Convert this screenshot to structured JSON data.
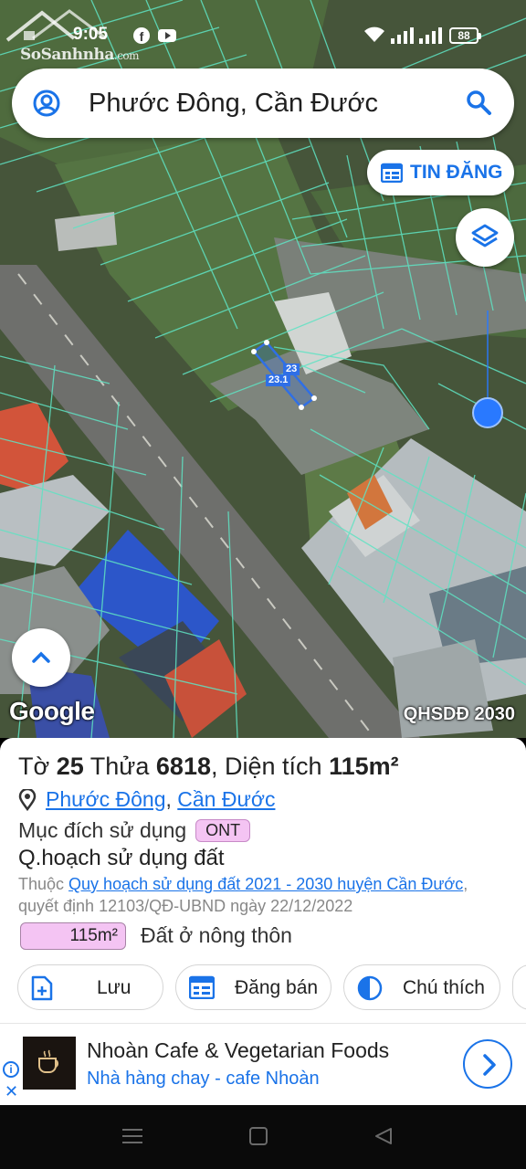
{
  "status_bar": {
    "time": "9:05",
    "battery": "88",
    "watermark_brand": "SoSanhnha",
    "watermark_domain": ".com",
    "icons": [
      "facebook-icon",
      "youtube-icon",
      "wifi-icon",
      "signal-icon",
      "signal-icon",
      "battery-icon"
    ]
  },
  "search": {
    "query": "Phước Đông, Cần Đước",
    "left_icon": "account-icon",
    "right_icon": "search-icon"
  },
  "map": {
    "post_button_label": "TIN ĐĂNG",
    "parcel_label_a": "23",
    "parcel_label_b": "23.1",
    "attribution": "Google",
    "overlay_label": "QHSDĐ 2030",
    "colors": {
      "parcel_lines": "#5fe3c3",
      "selected_parcel": "#2f6fe6",
      "location_dot": "#2979ff"
    }
  },
  "info": {
    "title_prefix": "Tờ",
    "sheet_no": "25",
    "parcel_word": "Thửa",
    "parcel_no": "6818",
    "area_word": ", Diện tích",
    "area_value": "115m²",
    "location_commune": "Phước Đông",
    "location_sep": ", ",
    "location_district": "Cần Đước",
    "purpose_label": "Mục đích sử dụng",
    "purpose_code": "ONT",
    "plan_label": "Q.hoạch sử dụng đất",
    "belongs_prefix": "Thuộc",
    "plan_link": "Quy hoạch sử dụng đất 2021 - 2030 huyện Cần Đước",
    "decision_text": ", quyết định 12103/QĐ-UBND ngày 22/12/2022",
    "area_badge": "115m²",
    "area_type": "Đất ở nông thôn",
    "colors": {
      "ont_badge": "#f4c4f3",
      "link": "#1a73e8"
    }
  },
  "actions": [
    {
      "label": "Lưu",
      "icon": "add-file-icon"
    },
    {
      "label": "Đăng bán",
      "icon": "calendar-icon"
    },
    {
      "label": "Chú thích",
      "icon": "legend-icon"
    }
  ],
  "ad": {
    "title": "Nhoàn Cafe & Vegetarian Foods",
    "subtitle": "Nhà hàng chay - cafe Nhoàn",
    "info_icon": "info-icon",
    "close_icon": "close-icon",
    "go_icon": "chevron-right-icon"
  },
  "nav": {
    "icons": [
      "menu-icon",
      "home-icon",
      "back-icon"
    ]
  }
}
